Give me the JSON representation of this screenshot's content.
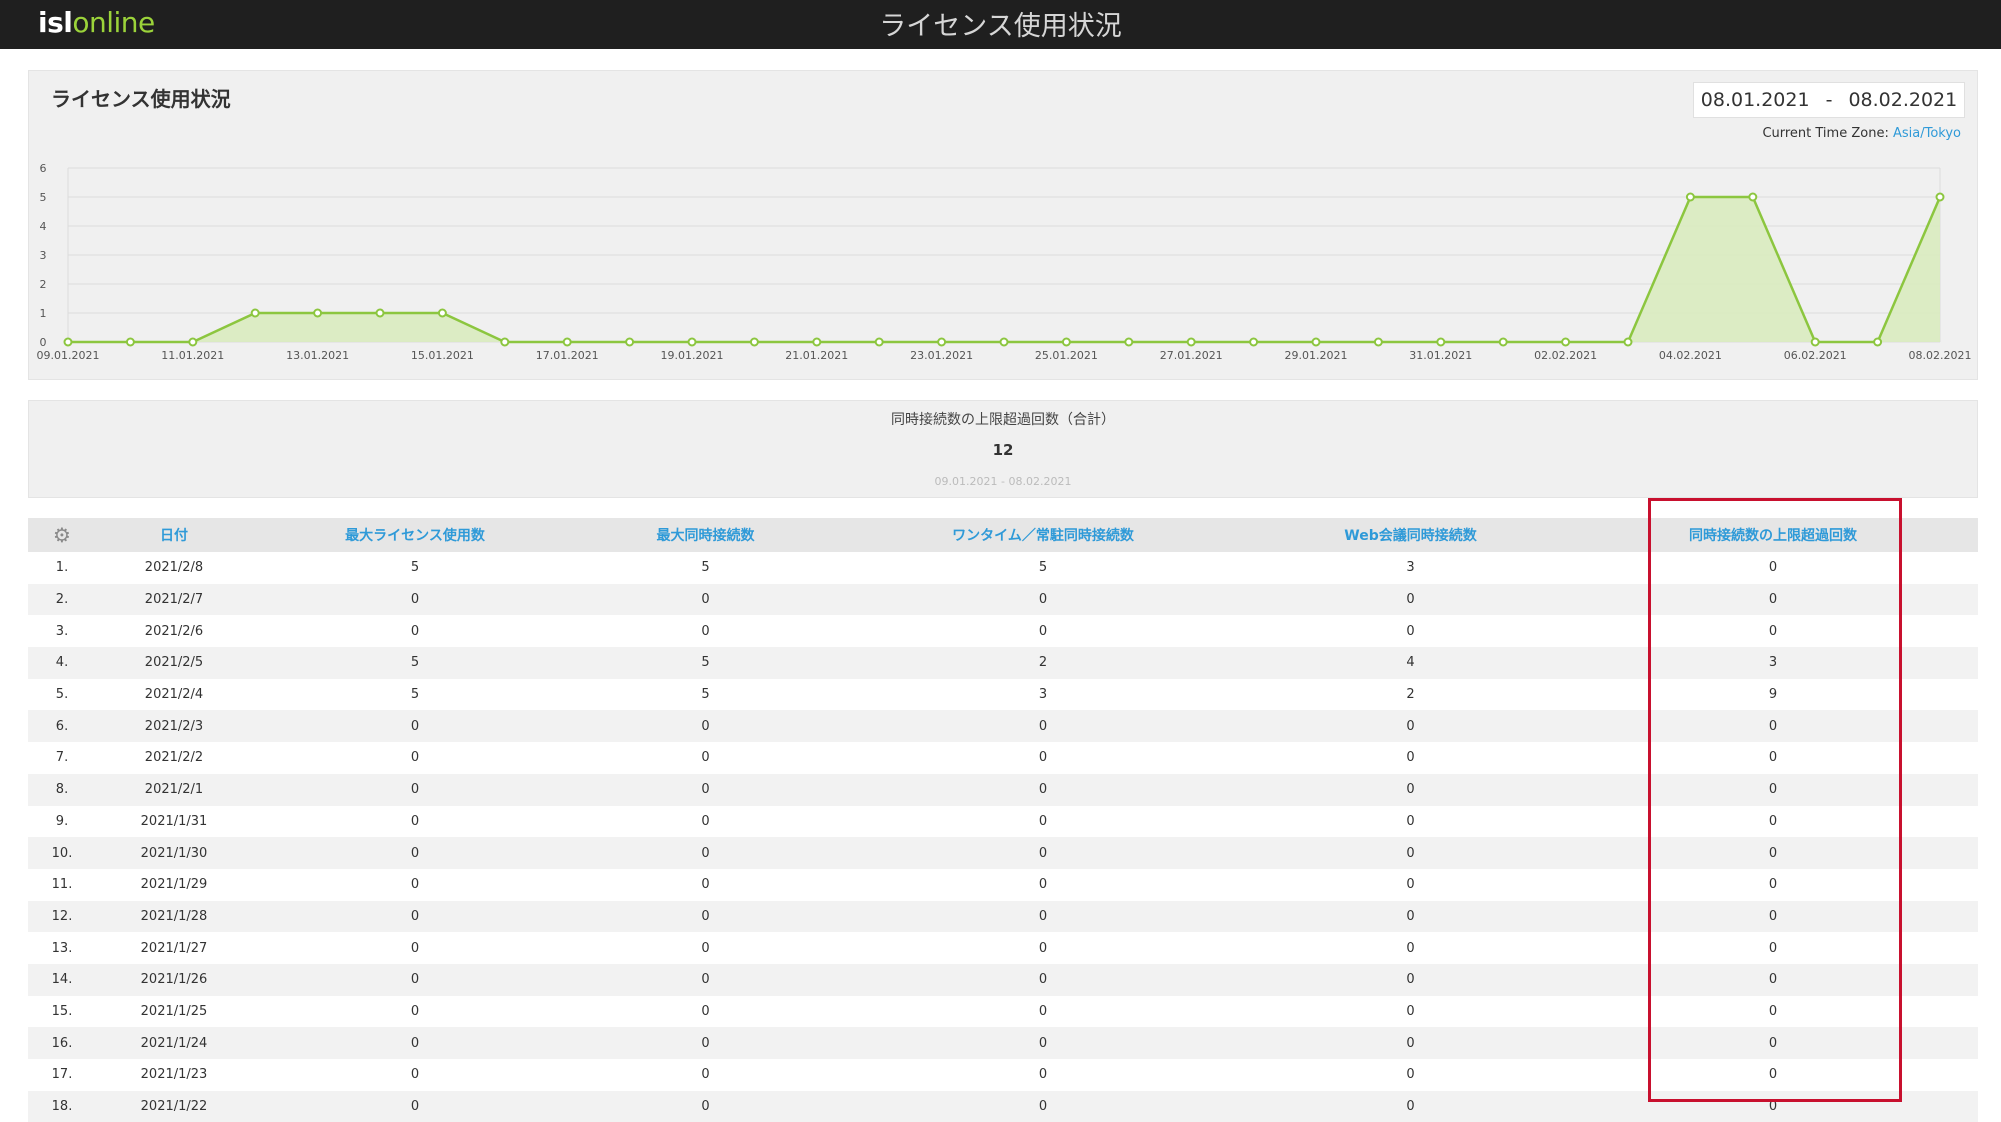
{
  "app": {
    "logo_part1": "isl",
    "logo_part2": "online",
    "page_title": "ライセンス使用状況"
  },
  "chart_panel": {
    "title": "ライセンス使用状況",
    "date_from": "08.01.2021",
    "date_sep": "-",
    "date_to": "08.02.2021",
    "timezone_label": "Current Time Zone:",
    "timezone_value": "Asia/Tokyo"
  },
  "chart_data": {
    "type": "area",
    "x": [
      "09.01.2021",
      "10.01.2021",
      "11.01.2021",
      "12.01.2021",
      "13.01.2021",
      "14.01.2021",
      "15.01.2021",
      "16.01.2021",
      "17.01.2021",
      "18.01.2021",
      "19.01.2021",
      "20.01.2021",
      "21.01.2021",
      "22.01.2021",
      "23.01.2021",
      "24.01.2021",
      "25.01.2021",
      "26.01.2021",
      "27.01.2021",
      "28.01.2021",
      "29.01.2021",
      "30.01.2021",
      "31.01.2021",
      "01.02.2021",
      "02.02.2021",
      "03.02.2021",
      "04.02.2021",
      "05.02.2021",
      "06.02.2021",
      "07.02.2021",
      "08.02.2021"
    ],
    "series": [
      {
        "values": [
          0,
          0,
          0,
          1,
          1,
          1,
          1,
          0,
          0,
          0,
          0,
          0,
          0,
          0,
          0,
          0,
          0,
          0,
          0,
          0,
          0,
          0,
          0,
          0,
          0,
          0,
          5,
          5,
          0,
          0,
          5
        ]
      }
    ],
    "x_tick_labels": [
      "09.01.2021",
      "11.01.2021",
      "13.01.2021",
      "15.01.2021",
      "17.01.2021",
      "19.01.2021",
      "21.01.2021",
      "23.01.2021",
      "25.01.2021",
      "27.01.2021",
      "29.01.2021",
      "31.01.2021",
      "02.02.2021",
      "04.02.2021",
      "06.02.2021",
      "08.02.2021"
    ],
    "y_tick_labels": [
      "0",
      "1",
      "2",
      "3",
      "4",
      "5",
      "6"
    ],
    "ylim": [
      0,
      6
    ],
    "grid": true,
    "line_color": "#8cc63f",
    "fill_color": "#d9ebbf"
  },
  "summary": {
    "label": "同時接続数の上限超過回数（合計）",
    "value": "12",
    "range": "09.01.2021 - 08.02.2021"
  },
  "table": {
    "headers": [
      "日付",
      "最大ライセンス使用数",
      "最大同時接続数",
      "ワンタイム／常駐同時接続数",
      "Web会議同時接続数",
      "同時接続数の上限超過回数"
    ],
    "rows": [
      [
        "1.",
        "2021/2/8",
        "5",
        "5",
        "5",
        "3",
        "0"
      ],
      [
        "2.",
        "2021/2/7",
        "0",
        "0",
        "0",
        "0",
        "0"
      ],
      [
        "3.",
        "2021/2/6",
        "0",
        "0",
        "0",
        "0",
        "0"
      ],
      [
        "4.",
        "2021/2/5",
        "5",
        "5",
        "2",
        "4",
        "3"
      ],
      [
        "5.",
        "2021/2/4",
        "5",
        "5",
        "3",
        "2",
        "9"
      ],
      [
        "6.",
        "2021/2/3",
        "0",
        "0",
        "0",
        "0",
        "0"
      ],
      [
        "7.",
        "2021/2/2",
        "0",
        "0",
        "0",
        "0",
        "0"
      ],
      [
        "8.",
        "2021/2/1",
        "0",
        "0",
        "0",
        "0",
        "0"
      ],
      [
        "9.",
        "2021/1/31",
        "0",
        "0",
        "0",
        "0",
        "0"
      ],
      [
        "10.",
        "2021/1/30",
        "0",
        "0",
        "0",
        "0",
        "0"
      ],
      [
        "11.",
        "2021/1/29",
        "0",
        "0",
        "0",
        "0",
        "0"
      ],
      [
        "12.",
        "2021/1/28",
        "0",
        "0",
        "0",
        "0",
        "0"
      ],
      [
        "13.",
        "2021/1/27",
        "0",
        "0",
        "0",
        "0",
        "0"
      ],
      [
        "14.",
        "2021/1/26",
        "0",
        "0",
        "0",
        "0",
        "0"
      ],
      [
        "15.",
        "2021/1/25",
        "0",
        "0",
        "0",
        "0",
        "0"
      ],
      [
        "16.",
        "2021/1/24",
        "0",
        "0",
        "0",
        "0",
        "0"
      ],
      [
        "17.",
        "2021/1/23",
        "0",
        "0",
        "0",
        "0",
        "0"
      ],
      [
        "18.",
        "2021/1/22",
        "0",
        "0",
        "0",
        "0",
        "0"
      ]
    ]
  },
  "icons": {
    "settings": "gear-icon"
  },
  "colors": {
    "header_link": "#2f9ad8",
    "highlight_border": "#c8102e",
    "topbar": "#1f1f1f"
  }
}
